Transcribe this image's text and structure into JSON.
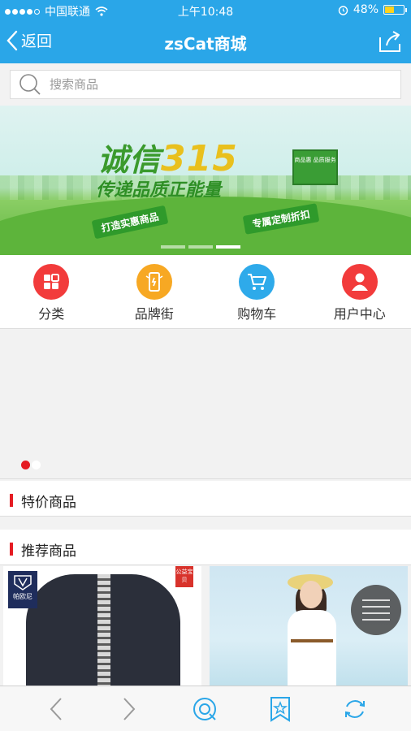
{
  "status_bar": {
    "carrier": "中国联通",
    "time": "上午10:48",
    "battery": "48%",
    "battery_level": 0.48
  },
  "nav": {
    "back_label": "返回",
    "title": "zsCat商城"
  },
  "search": {
    "placeholder": "搜索商品"
  },
  "banner": {
    "headline_prefix": "诚信",
    "headline_number": "315",
    "subline": "传递品质正能量",
    "ribbon_left": "打造实惠商品",
    "ribbon_right": "专属定制折扣",
    "box_text": "商品惠 品质服务",
    "active_slide": 3,
    "slide_count": 3
  },
  "quick_menu": [
    {
      "label": "分类",
      "icon": "category-icon",
      "color": "#f23b3b"
    },
    {
      "label": "品牌街",
      "icon": "brand-street-icon",
      "color": "#f7a823"
    },
    {
      "label": "购物车",
      "icon": "cart-icon",
      "color": "#2eaaea"
    },
    {
      "label": "用户中心",
      "icon": "user-icon",
      "color": "#f23b3b"
    }
  ],
  "sections": {
    "special": "特价商品",
    "recommended": "推荐商品"
  },
  "products": [
    {
      "brand_text": "帕欧尼",
      "tag_text": "公益宝贝"
    },
    {}
  ],
  "colors": {
    "primary": "#2aa6e8",
    "accent": "#e51c23"
  }
}
